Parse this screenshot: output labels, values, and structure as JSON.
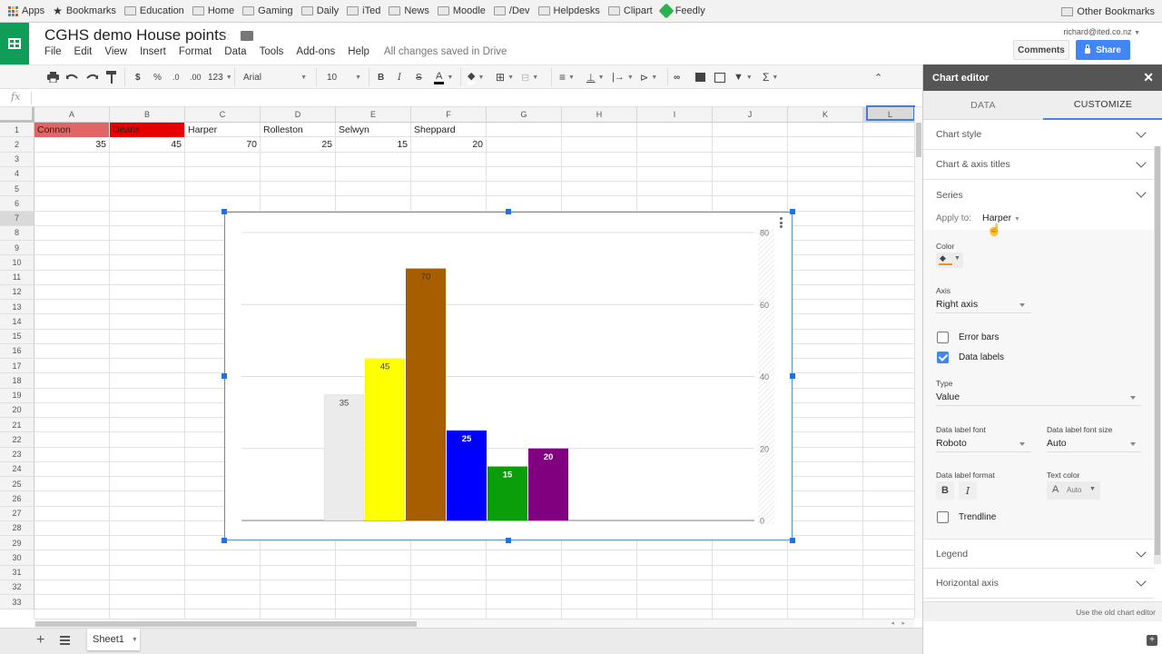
{
  "browser": {
    "bookmarks": [
      {
        "label": "Apps",
        "icon": "apps-grid-icon"
      },
      {
        "label": "Bookmarks",
        "icon": "star-icon"
      },
      {
        "label": "Education",
        "icon": "folder-icon"
      },
      {
        "label": "Home",
        "icon": "folder-icon"
      },
      {
        "label": "Gaming",
        "icon": "folder-icon"
      },
      {
        "label": "Daily",
        "icon": "folder-icon"
      },
      {
        "label": "iTed",
        "icon": "folder-icon"
      },
      {
        "label": "News",
        "icon": "folder-icon"
      },
      {
        "label": "Moodle",
        "icon": "folder-icon"
      },
      {
        "label": "/Dev",
        "icon": "folder-icon"
      },
      {
        "label": "Helpdesks",
        "icon": "folder-icon"
      },
      {
        "label": "Clipart",
        "icon": "folder-icon"
      },
      {
        "label": "Feedly",
        "icon": "feedly-icon"
      }
    ],
    "other_bookmarks": "Other Bookmarks"
  },
  "header": {
    "title": "CGHS demo House points",
    "account": "richard@ited.co.nz",
    "comments_label": "Comments",
    "share_label": "Share",
    "menu": [
      "File",
      "Edit",
      "View",
      "Insert",
      "Format",
      "Data",
      "Tools",
      "Add-ons",
      "Help"
    ],
    "save_status": "All changes saved in Drive"
  },
  "toolbar": {
    "currency": "$",
    "percent": "%",
    "dec_decrease": ".0",
    "dec_increase": ".00",
    "more_formats": "123",
    "font": "Arial",
    "font_size": "10",
    "bold": "B",
    "italic": "I",
    "strike": "S",
    "text_color": "A",
    "functions": "Σ"
  },
  "formula_bar": {
    "fx_label": "fx",
    "value": ""
  },
  "sheet": {
    "columns": [
      "A",
      "B",
      "C",
      "D",
      "E",
      "F",
      "G",
      "H",
      "I",
      "J",
      "K",
      "L"
    ],
    "rows": [
      "1",
      "2",
      "3",
      "4",
      "5",
      "6",
      "7",
      "8",
      "9",
      "10",
      "11",
      "12",
      "13",
      "14",
      "15",
      "16",
      "17",
      "18",
      "19",
      "20",
      "21",
      "22",
      "23",
      "24",
      "25",
      "26",
      "27",
      "28",
      "29",
      "30",
      "31",
      "32",
      "33"
    ],
    "selected_row": "7",
    "selected_column": "L",
    "row1": [
      {
        "value": "Connon",
        "bg": "#e06666"
      },
      {
        "value": "Deans",
        "bg": "#e60000"
      },
      {
        "value": "Harper",
        "bg": ""
      },
      {
        "value": "Rolleston",
        "bg": ""
      },
      {
        "value": "Selwyn",
        "bg": ""
      },
      {
        "value": "Sheppard",
        "bg": ""
      }
    ],
    "row2": [
      "35",
      "45",
      "70",
      "25",
      "15",
      "20"
    ],
    "tabs": [
      {
        "label": "Sheet1"
      }
    ]
  },
  "chart_data": {
    "type": "bar",
    "title": "",
    "xlabel": "",
    "ylabel": "",
    "categories": [
      "Connon",
      "Deans",
      "Harper",
      "Rolleston",
      "Selwyn",
      "Sheppard"
    ],
    "series": [
      {
        "name": "Connon",
        "values": [
          35
        ],
        "color": "#ebebeb",
        "label_color": "#444444"
      },
      {
        "name": "Deans",
        "values": [
          45
        ],
        "color": "#ffff00",
        "label_color": "#444444"
      },
      {
        "name": "Harper",
        "values": [
          70
        ],
        "color": "#a65e00",
        "label_color": "#333333"
      },
      {
        "name": "Rolleston",
        "values": [
          25
        ],
        "color": "#0000ff",
        "label_color": "#ffffff"
      },
      {
        "name": "Selwyn",
        "values": [
          15
        ],
        "color": "#0a9f0a",
        "label_color": "#ffffff"
      },
      {
        "name": "Sheppard",
        "values": [
          20
        ],
        "color": "#800080",
        "label_color": "#ffffff"
      }
    ],
    "y_axis": {
      "position": "right",
      "ticks": [
        0,
        20,
        40,
        60,
        80
      ],
      "ylim": [
        0,
        80
      ]
    },
    "grid": true,
    "data_labels": true,
    "legend": "none"
  },
  "editor": {
    "title": "Chart editor",
    "tabs": [
      {
        "label": "DATA",
        "active": false
      },
      {
        "label": "CUSTOMIZE",
        "active": true
      }
    ],
    "sections": {
      "chart_style": "Chart style",
      "titles": "Chart & axis titles",
      "series": "Series",
      "legend": "Legend",
      "horizontal_axis": "Horizontal axis"
    },
    "series": {
      "apply_to_label": "Apply to:",
      "apply_to_value": "Harper",
      "color_label": "Color",
      "color_value": "#e69138",
      "axis_label": "Axis",
      "axis_value": "Right axis",
      "error_bars_label": "Error bars",
      "error_bars_checked": false,
      "data_labels_label": "Data labels",
      "data_labels_checked": true,
      "type_label": "Type",
      "type_value": "Value",
      "font_label": "Data label font",
      "font_value": "Roboto",
      "font_size_label": "Data label font size",
      "font_size_value": "Auto",
      "format_label": "Data label format",
      "bold_label": "B",
      "italic_label": "I",
      "text_color_label": "Text color",
      "text_color_glyph": "A",
      "text_color_value": "Auto",
      "trendline_label": "Trendline",
      "trendline_checked": false
    },
    "footer_link": "Use the old chart editor"
  }
}
